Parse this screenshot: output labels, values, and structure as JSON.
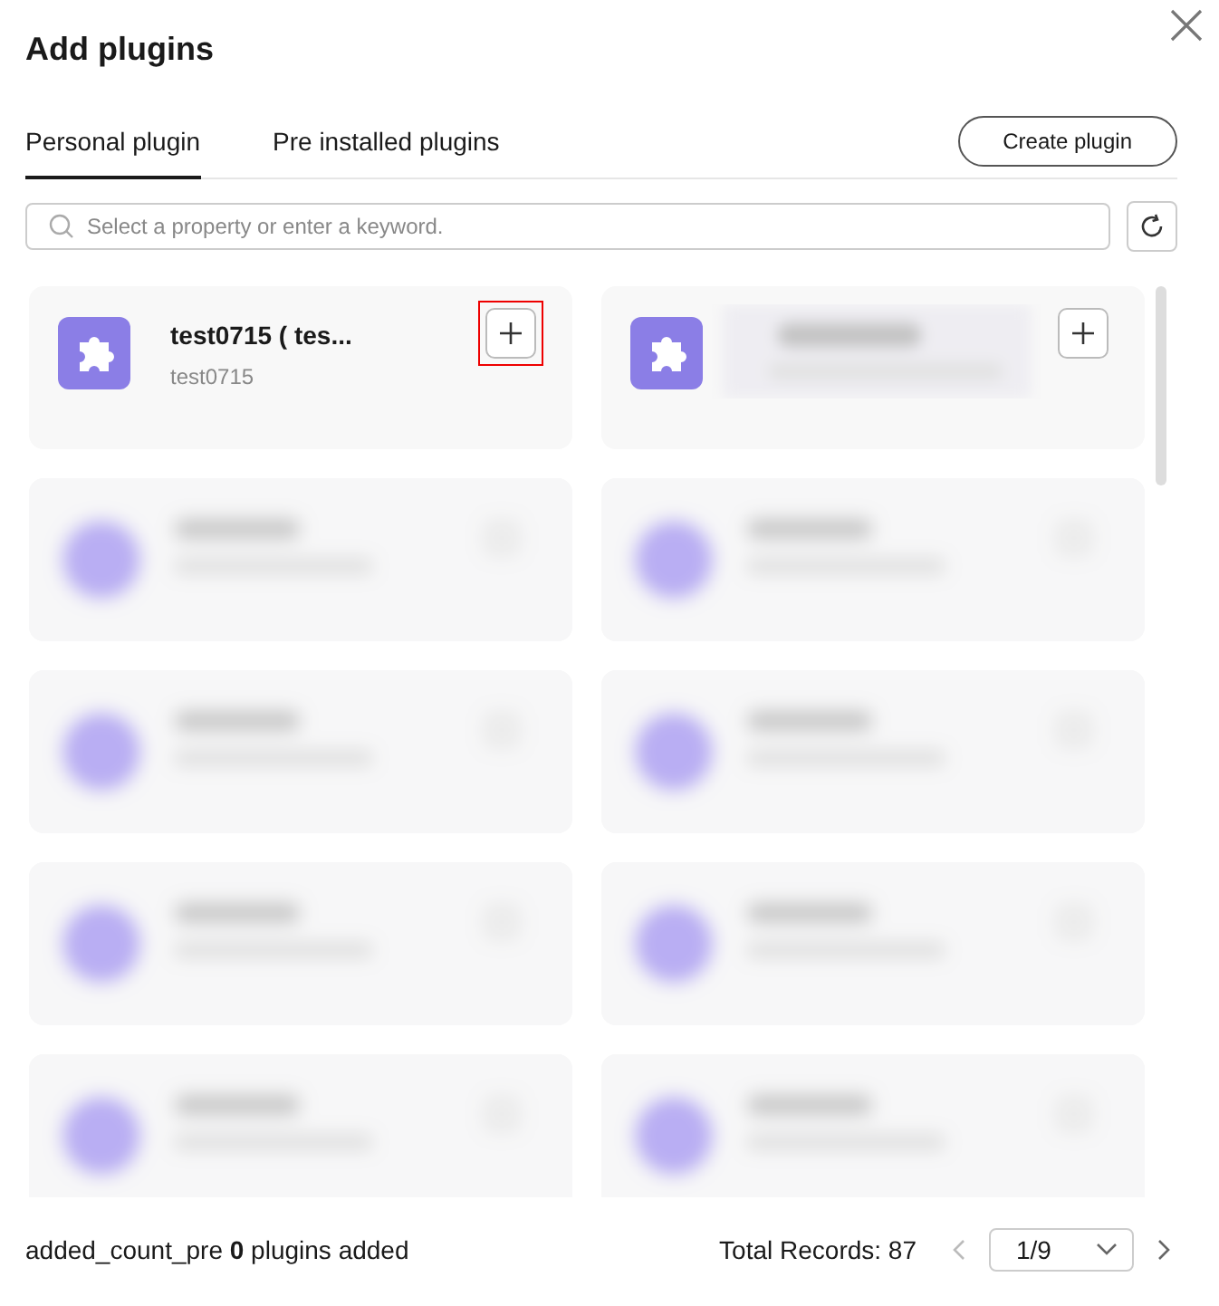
{
  "dialog": {
    "title": "Add plugins"
  },
  "tabs": [
    {
      "label": "Personal plugin",
      "selected": true
    },
    {
      "label": "Pre installed plugins",
      "selected": false
    }
  ],
  "create_button": "Create plugin",
  "search": {
    "placeholder": "Select a property or enter a keyword."
  },
  "plugins": [
    {
      "kind": "plugin",
      "name": "test0715 ( tes...",
      "description": "test0715",
      "highlighted": true
    },
    {
      "kind": "partly_redacted",
      "highlighted": false
    },
    {
      "kind": "redacted"
    },
    {
      "kind": "redacted"
    },
    {
      "kind": "redacted"
    },
    {
      "kind": "redacted"
    },
    {
      "kind": "redacted"
    },
    {
      "kind": "redacted"
    },
    {
      "kind": "redacted"
    },
    {
      "kind": "redacted"
    }
  ],
  "footer": {
    "added": "added_count_pre **0** plugins added",
    "total": "Total Records: 87",
    "page": "1/9"
  }
}
